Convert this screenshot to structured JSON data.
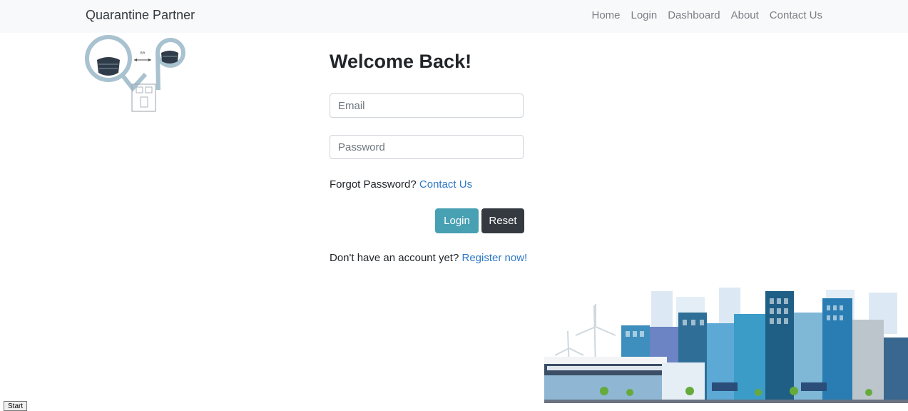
{
  "nav": {
    "brand": "Quarantine Partner",
    "links": [
      "Home",
      "Login",
      "Dashboard",
      "About",
      "Contact Us"
    ]
  },
  "logo": {
    "distance_label": "6ft"
  },
  "login": {
    "title": "Welcome Back!",
    "email_placeholder": "Email",
    "password_placeholder": "Password",
    "forgot_text": "Forgot Password?",
    "forgot_link": "Contact Us",
    "login_button": "Login",
    "reset_button": "Reset",
    "register_text": "Don't have an account yet?",
    "register_link": "Register now!"
  },
  "footer": {
    "start_button": "Start"
  },
  "colors": {
    "navbar_bg": "#f8f9fa",
    "login_button": "#48a0b3",
    "reset_button": "#343a40",
    "link": "#2e78c7"
  }
}
